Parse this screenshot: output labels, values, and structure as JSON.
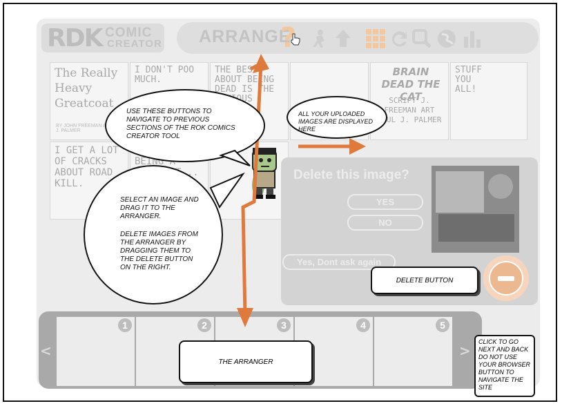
{
  "logo": {
    "brand": "RDK",
    "line1": "COMIC",
    "line2": "CREATOR"
  },
  "nav": {
    "section_title": "ARRANGE",
    "help_glyph": "?",
    "icons": [
      "hand-pointer-icon",
      "figure-icon",
      "upload-arrow-icon",
      "grid-icon",
      "back-arrow-icon",
      "magnify-icon",
      "globe-icon",
      "chart-icon"
    ]
  },
  "panels": [
    {
      "text": "The Really Heavy Greatcoat",
      "credit": "BY JOHN FREEMAN AND PAUL J. PALMER"
    },
    {
      "text": "I don't poo much."
    },
    {
      "text": "The best about being dead is the obvious perks..."
    },
    {
      "text": ""
    },
    {
      "text": "Brain Dead the Cat",
      "sub": "Script J. Freeman Art Paul J. Palmer"
    },
    {
      "text": "Stuff you all!"
    },
    {
      "text": "I get a lot of cracks about road kill."
    },
    {
      "text": "It's no fun being a dead cat..."
    },
    {
      "text": ""
    },
    {
      "text": ""
    }
  ],
  "delete_panel": {
    "title": "Delete this image?",
    "yes": "YES",
    "no": "NO",
    "dont_ask": "Yes, Dont ask again"
  },
  "arranger": {
    "slots": [
      "1",
      "2",
      "3",
      "4",
      "5"
    ],
    "prev": "<",
    "next": ">"
  },
  "annotations": {
    "nav_tip": "USE THESE BUTTONS TO NAVIGATE TO PREVIOUS SECTIONS OF THE ROK COMICS CREATOR TOOL",
    "uploaded_tip": "ALL YOUR UPLOADED IMAGES ARE DISPLAYED HERE",
    "drag_tip": "SELECT AN IMAGE AND DRAG IT TO THE ARRANGER.",
    "delete_tip": "DELETE IMAGES FROM THE ARRANGER BY DRAGGING THEM TO THE DELETE BUTTON ON THE RIGHT.",
    "delete_button_label": "DELETE BUTTON",
    "arranger_label": "THE ARRANGER",
    "next_back_tip": "CLICK TO GO NEXT AND BACK DO NOT USE YOUR BROWSER BUTTON TO NAVIGATE THE SITE"
  },
  "colors": {
    "accent_orange": "#e07a3c",
    "panel_grey": "#ececec",
    "arranger_grey": "#a9a9a9"
  }
}
